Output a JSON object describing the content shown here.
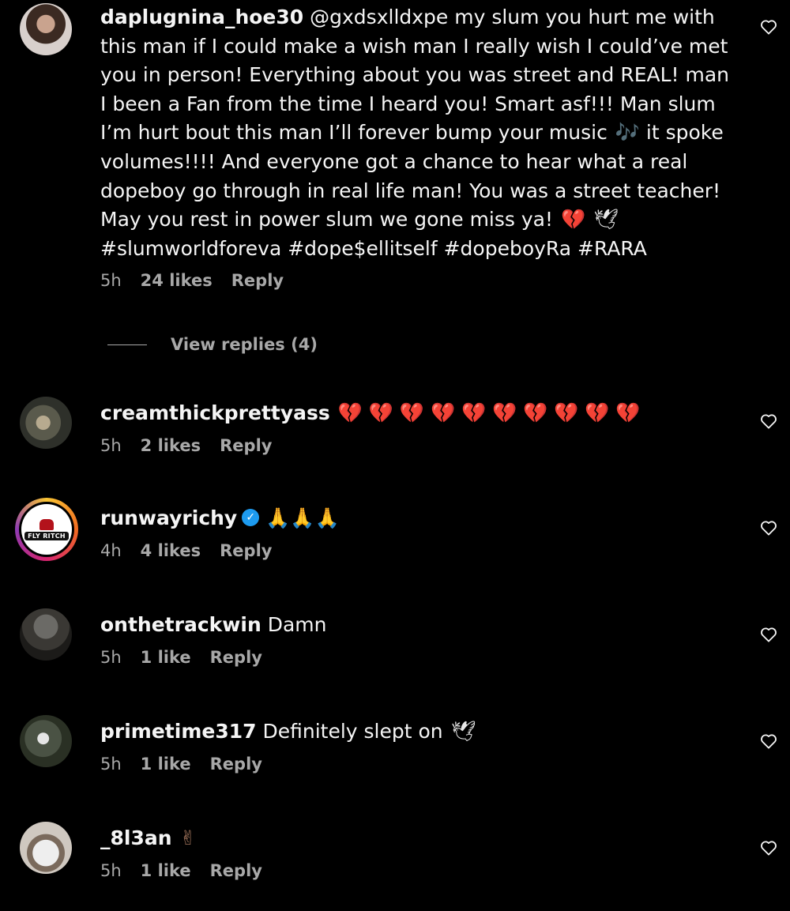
{
  "comments": [
    {
      "username": "daplugnina_hoe30",
      "text_part1": "@gxdsxlldxpe my slum you hurt me with this man if I could make a wish man I really wish I could’ve met you in person! Everything about you was street and REAL! man I been a Fan from the time I heard you! Smart asf!!! Man slum I’m hurt bout this man I’ll forever bump your music ",
      "emoji_note": "🎶",
      "text_part2": " it spoke volumes!!!! And everyone got a chance to hear what a real dopeboy go through in real life man! You was a street teacher! May you rest in power slum we gone miss ya! ",
      "emoji_heart": "💔",
      "emoji_dove": "🕊",
      "hashtags": "#slumworldforeva #dope$ellitself #dopeboyRa #RARA",
      "time": "5h",
      "likes": "24 likes",
      "reply": "Reply",
      "view_replies": "View replies (4)"
    },
    {
      "username": "creamthickprettyass",
      "emojis": "💔 💔 💔 💔 💔 💔 💔 💔 💔 💔",
      "time": "5h",
      "likes": "2 likes",
      "reply": "Reply"
    },
    {
      "username": "runwayrichy",
      "verified_mark": "✓",
      "emojis": "🙏🙏🙏",
      "avatar_logo_text": "FLY RITCH",
      "time": "4h",
      "likes": "4 likes",
      "reply": "Reply"
    },
    {
      "username": "onthetrackwin",
      "text": "Damn",
      "time": "5h",
      "likes": "1 like",
      "reply": "Reply"
    },
    {
      "username": "primetime317",
      "text": "Definitely slept on ",
      "emoji": "🕊",
      "time": "5h",
      "likes": "1 like",
      "reply": "Reply"
    },
    {
      "username": "_8l3an",
      "emoji": "✌",
      "time": "5h",
      "likes": "1 like",
      "reply": "Reply"
    }
  ],
  "icons": {
    "like": "heart-outline-icon",
    "verified": "verified-badge-icon"
  },
  "colors": {
    "background": "#000000",
    "text": "#f5f5f5",
    "meta": "#a8a8a8",
    "heart_emoji": "#ff2f6d",
    "verified": "#1d9bf0"
  }
}
